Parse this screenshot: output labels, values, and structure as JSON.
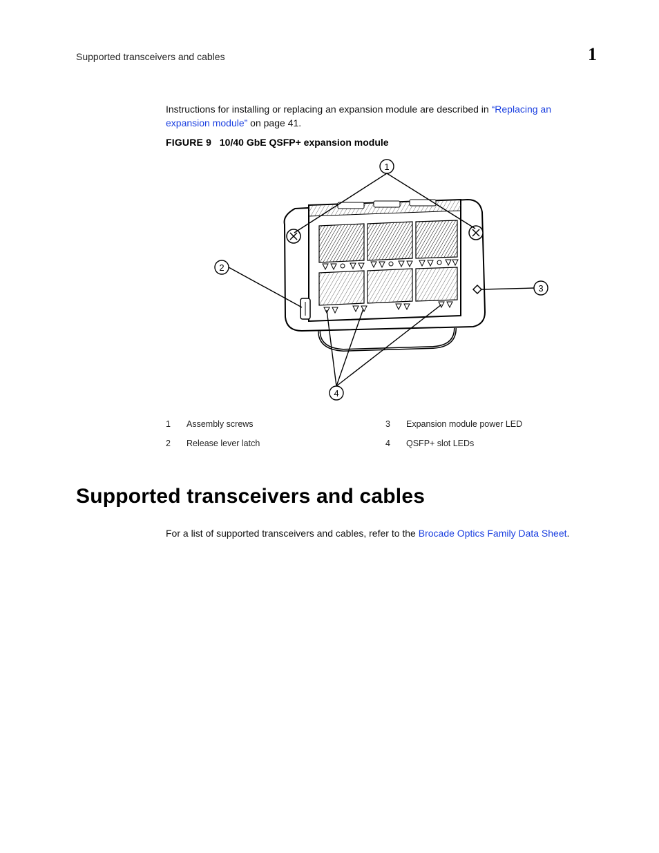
{
  "header": {
    "running_title": "Supported transceivers and cables",
    "chapter_number": "1"
  },
  "intro": {
    "p1_prefix": "Instructions for installing or replacing an expansion module are described in ",
    "p1_link": "“Replacing an expansion module”",
    "p1_suffix": " on page 41."
  },
  "figure": {
    "label": "FIGURE 9",
    "title": "10/40 GbE QSFP+ expansion module",
    "callouts": {
      "c1": "1",
      "c2": "2",
      "c3": "3",
      "c4": "4"
    },
    "legend": [
      {
        "num": "1",
        "text": "Assembly screws"
      },
      {
        "num": "2",
        "text": "Release lever latch"
      },
      {
        "num": "3",
        "text": "Expansion module power LED"
      },
      {
        "num": "4",
        "text": "QSFP+ slot LEDs"
      }
    ]
  },
  "section": {
    "title": "Supported transceivers and cables",
    "p1_prefix": "For a list of supported transceivers and cables, refer to the ",
    "p1_link": "Brocade Optics Family Data Sheet",
    "p1_suffix": "."
  }
}
